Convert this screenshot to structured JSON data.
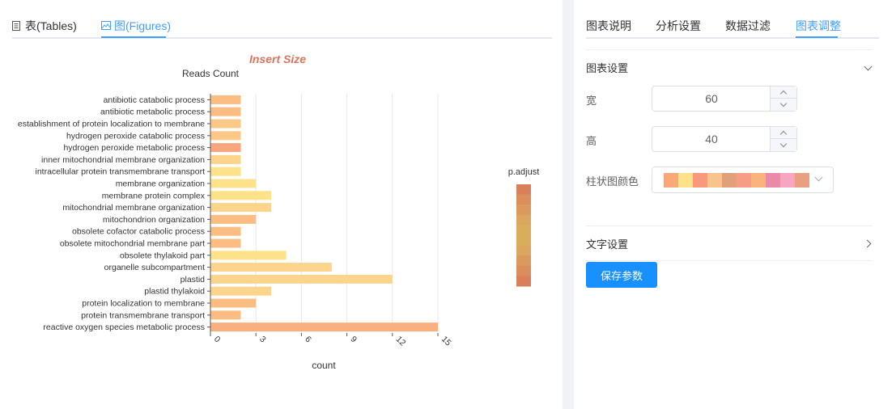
{
  "left_tabs": [
    {
      "label": "表(Tables)",
      "icon": "document-icon"
    },
    {
      "label": "图(Figures)",
      "icon": "image-icon"
    }
  ],
  "right_tabs": [
    {
      "label": "图表说明"
    },
    {
      "label": "分析设置"
    },
    {
      "label": "数据过滤"
    },
    {
      "label": "图表调整"
    }
  ],
  "active_right_tab": "图表调整",
  "chart_settings": {
    "title": "图表设置",
    "width_label": "宽",
    "width_value": "60",
    "height_label": "高",
    "height_value": "40",
    "bar_color_label": "柱状图颜色",
    "palette": [
      "#f9a878",
      "#fde28a",
      "#f9987a",
      "#f9c48c",
      "#e2a07a",
      "#f79d86",
      "#fbb37e",
      "#e98aa8",
      "#f7a5c0",
      "#eaa07e"
    ]
  },
  "text_settings": {
    "title": "文字设置"
  },
  "save_button": {
    "label": "保存参数"
  },
  "chart_data": {
    "type": "bar",
    "orientation": "horizontal",
    "title": "Insert Size",
    "subtitle": "Reads Count",
    "xlabel": "count",
    "ylabel": "",
    "xlim": [
      0,
      15
    ],
    "xticks": [
      "0",
      "3",
      "6",
      "9",
      "12",
      "15"
    ],
    "grid": true,
    "legend": {
      "title": "p.adjust",
      "placement": "right"
    },
    "categories": [
      "antibiotic catabolic process",
      "antibiotic metabolic process",
      "establishment of protein localization to membrane",
      "hydrogen peroxide catabolic process",
      "hydrogen peroxide metabolic process",
      "inner mitochondrial membrane organization",
      "intracellular protein transmembrane transport",
      "membrane organization",
      "membrane protein complex",
      "mitochondrial membrane organization",
      "mitochondrion organization",
      "obsolete cofactor catabolic process",
      "obsolete mitochondrial membrane part",
      "obsolete thylakoid part",
      "organelle subcompartment",
      "plastid",
      "plastid thylakoid",
      "protein localization to membrane",
      "protein transmembrane transport",
      "reactive oxygen species metabolic process"
    ],
    "values": [
      2,
      2,
      2,
      2,
      2,
      2,
      2,
      3,
      4,
      4,
      3,
      2,
      2,
      5,
      8,
      12,
      4,
      3,
      2,
      15
    ],
    "bar_colors": [
      "#fbbd82",
      "#fbbd82",
      "#fcc888",
      "#fcc888",
      "#f7a67e",
      "#fcd48c",
      "#fde28a",
      "#fde28a",
      "#fde28a",
      "#fcd48c",
      "#fbbd82",
      "#fbbd82",
      "#fbbd82",
      "#fde28a",
      "#fcd48c",
      "#fcd48c",
      "#fcd48c",
      "#fbbd82",
      "#fbbd82",
      "#f9b07e"
    ],
    "legend_colors": [
      "#d9805a",
      "#d98e5c",
      "#da9a5e",
      "#dba660",
      "#d9ad5c",
      "#d9ad5c",
      "#dba660",
      "#da9a5e",
      "#d98e5c",
      "#d9805a"
    ]
  }
}
